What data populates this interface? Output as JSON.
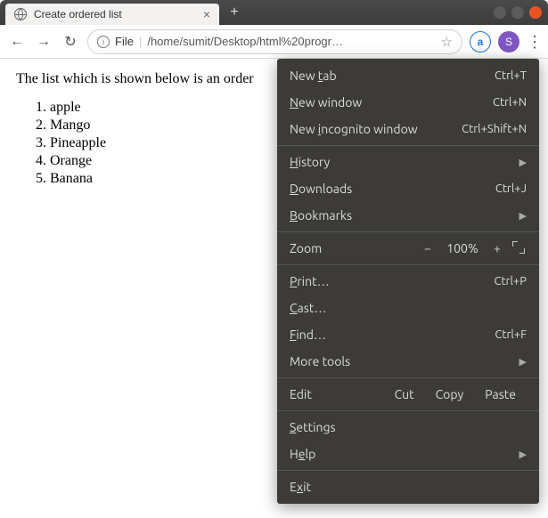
{
  "window": {
    "tab_title": "Create ordered list"
  },
  "url": {
    "file_label": "File",
    "path": "/home/sumit/Desktop/html%20progr…"
  },
  "avatar": {
    "letter": "S"
  },
  "page": {
    "intro": "The list which is shown below is an order",
    "items": [
      "apple",
      "Mango",
      "Pineapple",
      "Orange",
      "Banana"
    ]
  },
  "menu": {
    "new_tab": "New tab",
    "new_tab_sc": "Ctrl+T",
    "new_window": "New window",
    "new_window_sc": "Ctrl+N",
    "incognito": "New incognito window",
    "incognito_sc": "Ctrl+Shift+N",
    "history": "History",
    "downloads": "Downloads",
    "downloads_sc": "Ctrl+J",
    "bookmarks": "Bookmarks",
    "zoom": "Zoom",
    "zoom_value": "100%",
    "print": "Print…",
    "print_sc": "Ctrl+P",
    "cast": "Cast…",
    "find": "Find…",
    "find_sc": "Ctrl+F",
    "more_tools": "More tools",
    "edit": "Edit",
    "cut": "Cut",
    "copy": "Copy",
    "paste": "Paste",
    "settings": "Settings",
    "help": "Help",
    "exit": "Exit"
  }
}
